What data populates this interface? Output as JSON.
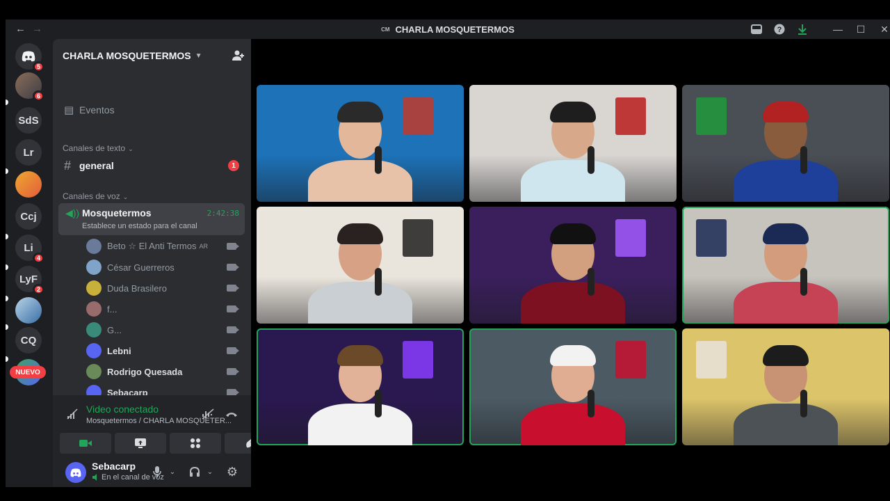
{
  "titlebar": {
    "server_abbrev": "CM",
    "title": "CHARLA MOSQUETERMOS"
  },
  "rail": {
    "home_badge": "5",
    "avatar_badge": "6",
    "servers": [
      {
        "label": "SdS",
        "badge": ""
      },
      {
        "label": "Lr",
        "badge": ""
      },
      {
        "label": "Ccj",
        "badge": ""
      },
      {
        "label": "Li",
        "badge": "4"
      },
      {
        "label": "LyF",
        "badge": "2"
      },
      {
        "label": "CQ",
        "badge": ""
      }
    ],
    "new_label": "NUEVO"
  },
  "sidebar": {
    "guild_name": "CHARLA MOSQUETERMOS",
    "events_label": "Eventos",
    "text_category": "Canales de texto",
    "text_channel": "general",
    "text_channel_badge": "1",
    "voice_category": "Canales de voz",
    "voice_channel": {
      "name": "Mosquetermos",
      "time": "2:42:38",
      "status": "Establece un estado para el canal"
    },
    "members": [
      {
        "name": "Beto ☆ El Anti Termos",
        "tag": "AR",
        "bold": false,
        "color": "#6a7a9a"
      },
      {
        "name": "César Guerreros",
        "tag": "",
        "bold": false,
        "color": "#7fa3c9"
      },
      {
        "name": "Duda Brasilero",
        "tag": "",
        "bold": false,
        "color": "#c9b03a"
      },
      {
        "name": "f...",
        "tag": "",
        "bold": false,
        "color": "#9a6b6b"
      },
      {
        "name": "G...",
        "tag": "",
        "bold": false,
        "color": "#3a8a7a"
      },
      {
        "name": "Lebni",
        "tag": "",
        "bold": true,
        "color": "#5865f2"
      },
      {
        "name": "Rodrigo Quesada",
        "tag": "",
        "bold": true,
        "color": "#6b8a5a"
      },
      {
        "name": "Sebacarp",
        "tag": "",
        "bold": true,
        "color": "#5865f2"
      }
    ]
  },
  "voice_panel": {
    "title": "Video conectado",
    "subtitle": "Mosquetermos / CHARLA MOSQUETER..."
  },
  "user": {
    "name": "Sebacarp",
    "status": "En el canal de voz"
  },
  "video_tiles": [
    {
      "bg": "#1d72b8",
      "skin": "#e2b79a",
      "shirt": "#e8c2a8",
      "hair": "#2a2a2a",
      "speaking": false,
      "accent": "#c0392b"
    },
    {
      "bg": "#d9d6d2",
      "skin": "#d8a88a",
      "shirt": "#cfe6ef",
      "hair": "#1e1e1e",
      "speaking": false,
      "accent": "#b71c1c"
    },
    {
      "bg": "#4a4e55",
      "skin": "#8a5c3e",
      "shirt": "#1e3f9a",
      "hair": "#b22222",
      "speaking": false,
      "accent": "#1f9a3c"
    },
    {
      "bg": "#e9e4dc",
      "skin": "#d6a184",
      "shirt": "#c9cfd3",
      "hair": "#2a2220",
      "speaking": false,
      "accent": "#202020"
    },
    {
      "bg": "#3a1f5c",
      "skin": "#d2a07e",
      "shirt": "#7d1021",
      "hair": "#111111",
      "speaking": false,
      "accent": "#a35bff"
    },
    {
      "bg": "#c7c3bd",
      "skin": "#d39c7c",
      "shirt": "#c64356",
      "hair": "#1a2a55",
      "speaking": true,
      "accent": "#1a2a55"
    },
    {
      "bg": "#2a1850",
      "skin": "#e2b298",
      "shirt": "#f2f2f2",
      "hair": "#6b4a2a",
      "speaking": true,
      "accent": "#8a3cff"
    },
    {
      "bg": "#4c5a63",
      "skin": "#e0ad92",
      "shirt": "#c8102e",
      "hair": "#f2f2f2",
      "speaking": true,
      "accent": "#c8102e"
    },
    {
      "bg": "#dcc46a",
      "skin": "#c89274",
      "shirt": "#4d5256",
      "hair": "#1c1c1c",
      "speaking": false,
      "accent": "#e7e3da"
    }
  ]
}
